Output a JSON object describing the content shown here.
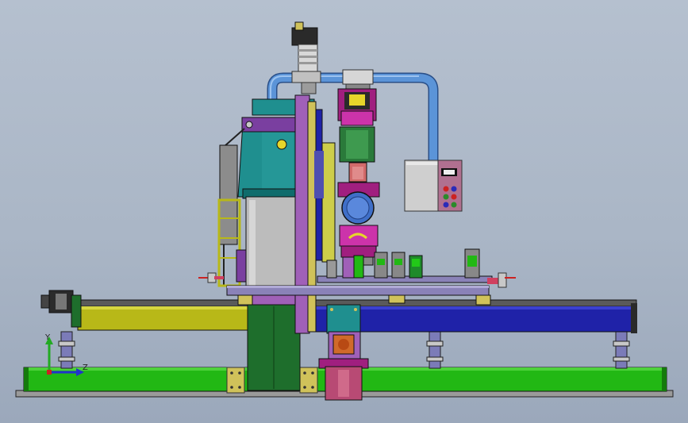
{
  "triad": {
    "y_label": "Y",
    "z_label": "Z"
  },
  "colors": {
    "background": "#aab6c6",
    "base_rail": "#22b814",
    "beam_yellow": "#b8b818",
    "beam_blue": "#1f22a8",
    "column_teal": "#1f8f8f",
    "column_green": "#1e6e2c",
    "column_grey": "#bcbcbc",
    "frame_purple": "#a060b8",
    "pipe_blue": "#5b94d8",
    "head_magenta": "#a01f7f",
    "control_box": "#cfcfcf",
    "table_top": "#8a82b8"
  }
}
